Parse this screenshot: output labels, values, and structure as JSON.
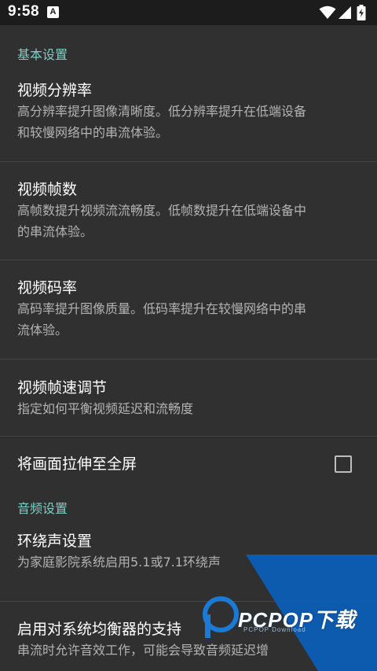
{
  "status_bar": {
    "time": "9:58",
    "app_icon_letter": "A"
  },
  "sections": {
    "basic_header": "基本设置",
    "audio_header": "音频设置"
  },
  "prefs": {
    "resolution": {
      "title": "视频分辨率",
      "summary_line1": "高分辨率提升图像清晰度。低分辨率提升在低端设备",
      "summary_line2": "和较慢网络中的串流体验。"
    },
    "fps": {
      "title": "视频帧数",
      "summary_line1": "高帧数提升视频流流畅度。低帧数提升在低端设备中",
      "summary_line2": "的串流体验。"
    },
    "bitrate": {
      "title": "视频码率",
      "summary_line1": "高码率提升图像质量。低码率提升在较慢网络中的串",
      "summary_line2": "流体验。"
    },
    "frame_pacing": {
      "title": "视频帧速调节",
      "summary": "指定如何平衡视频延迟和流畅度"
    },
    "stretch": {
      "title": "将画面拉伸至全屏",
      "checked": false
    },
    "surround": {
      "title": "环绕声设置",
      "summary": "为家庭影院系统启用5.1或7.1环绕声"
    },
    "equalizer": {
      "title": "启用对系统均衡器的支持",
      "summary": "串流时允许音效工作，可能会导致音频延迟增"
    }
  },
  "watermark": {
    "brand": "PCPOP下载",
    "sub": "PCPOP Download"
  },
  "colors": {
    "accent": "#80cbc4",
    "background": "#303030",
    "status_bar": "#1c1c1c",
    "watermark_blue": "#0b5fb8"
  }
}
